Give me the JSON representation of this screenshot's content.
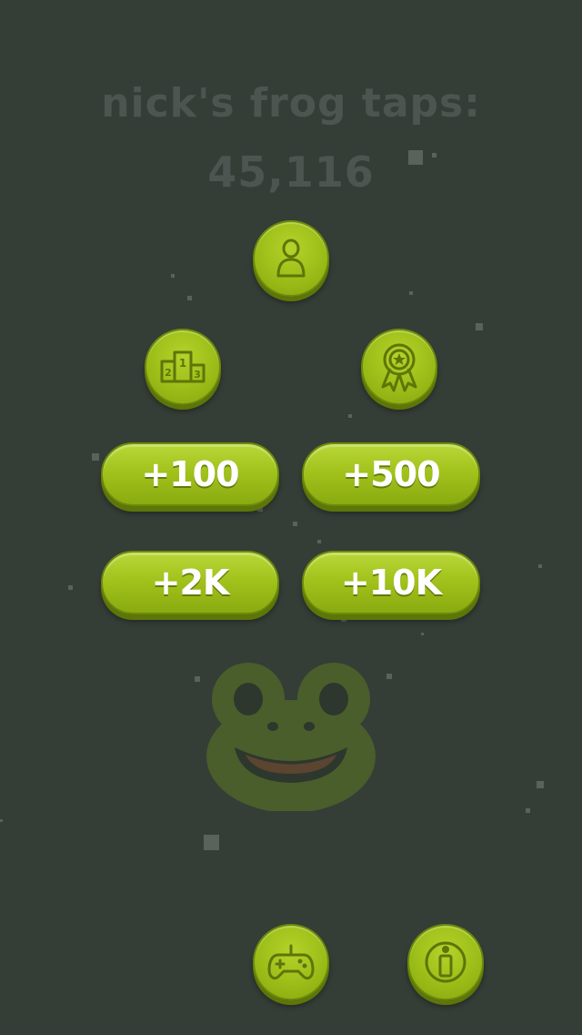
{
  "header": {
    "title": "nick's frog taps:",
    "count": "45,116"
  },
  "buttons": {
    "profile": {
      "icon": "profile-icon"
    },
    "leaderboard": {
      "icon": "podium-icon",
      "ranks": [
        "1",
        "2",
        "3"
      ]
    },
    "achievements": {
      "icon": "award-ribbon-icon"
    },
    "boosts": [
      {
        "label": "+100"
      },
      {
        "label": "+500"
      },
      {
        "label": "+2K"
      },
      {
        "label": "+10K"
      }
    ],
    "games": {
      "icon": "gamepad-icon"
    },
    "info": {
      "icon": "info-icon"
    }
  },
  "frog": {
    "icon": "frog-face-icon"
  },
  "colors": {
    "background": "#353d37",
    "button_green": "#a2c21c",
    "button_dark": "#6d8a0a",
    "title_text": "#4c554f",
    "label_text": "#ffffff"
  }
}
